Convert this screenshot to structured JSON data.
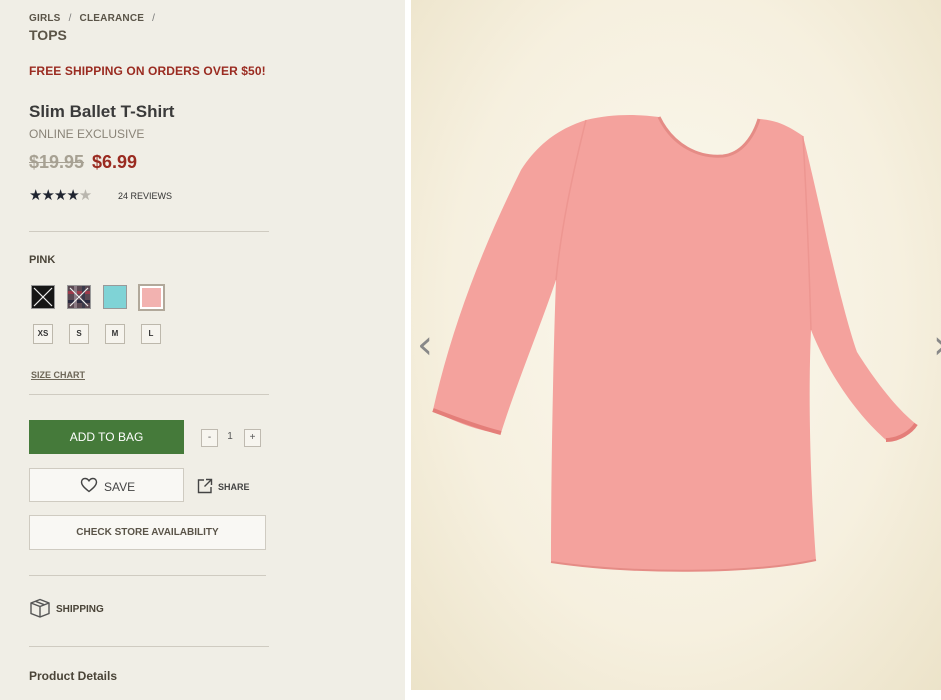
{
  "breadcrumb": {
    "items": [
      "GIRLS",
      "CLEARANCE"
    ],
    "separator": "/"
  },
  "category": "TOPS",
  "promo": "FREE SHIPPING ON ORDERS OVER $50!",
  "product": {
    "title": "Slim Ballet T-Shirt",
    "subtitle": "ONLINE EXCLUSIVE",
    "price_old": "$19.95",
    "price_new": "$6.99",
    "rating": 4.5,
    "stars": "★★★★",
    "half_star": "★",
    "reviews": "24 REVIEWS"
  },
  "color": {
    "selected_label": "PINK",
    "swatches": [
      {
        "name": "black",
        "hex": "#1a1a1a"
      },
      {
        "name": "plaid",
        "hex": "#6a5058"
      },
      {
        "name": "turquoise",
        "hex": "#7fd3d6"
      },
      {
        "name": "pink",
        "hex": "#f2b2b0"
      }
    ]
  },
  "sizes": [
    "XS",
    "S",
    "M",
    "L"
  ],
  "size_chart": "SIZE CHART",
  "actions": {
    "add_to_bag": "ADD TO BAG",
    "qty_minus": "-",
    "qty": "1",
    "qty_plus": "+",
    "save": "SAVE",
    "share": "SHARE",
    "store": "CHECK STORE AVAILABILITY"
  },
  "shipping": "SHIPPING",
  "details": "Product Details",
  "gallery": {
    "prev": "‹",
    "next": "›"
  },
  "colors": {
    "accent_red": "#9a2b21",
    "add_green": "#457a3a",
    "shirt_pink": "#f4a29d"
  }
}
